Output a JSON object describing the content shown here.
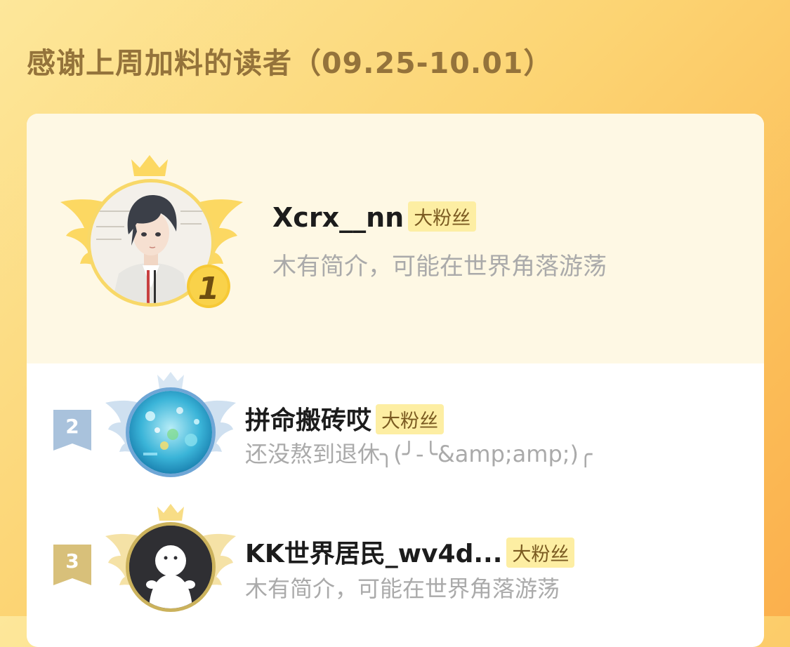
{
  "header": {
    "title": "感谢上周加料的读者（09.25-10.01）"
  },
  "readers": [
    {
      "rank": "1",
      "name": "Xcrx__nn",
      "badge": "大粉丝",
      "bio": "木有简介，可能在世界角落游荡"
    },
    {
      "rank": "2",
      "name": "拼命搬砖哎",
      "badge": "大粉丝",
      "bio": "还没熬到退休╮(╯-╰&amp;amp;)╭"
    },
    {
      "rank": "3",
      "name": "KK世界居民_wv4d...",
      "badge": "大粉丝",
      "bio": "木有简介，可能在世界角落游荡"
    }
  ],
  "colors": {
    "gold": "#f6c936",
    "silver": "#a9c2dc",
    "bronze": "#d8c07a",
    "title": "#94733b",
    "badge_bg": "#fdeea3"
  }
}
